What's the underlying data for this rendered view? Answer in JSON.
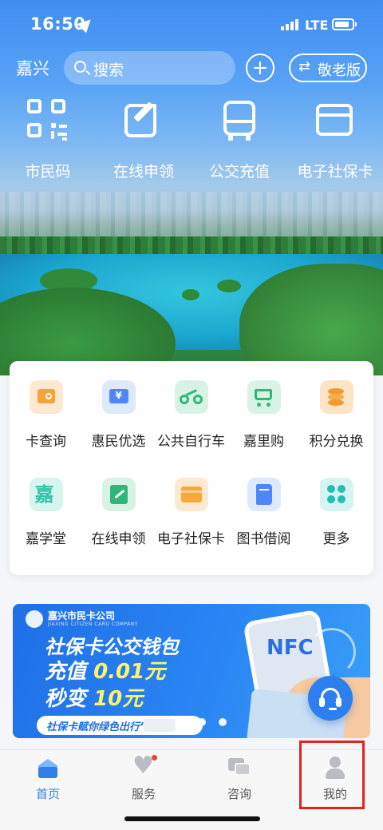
{
  "status": {
    "time": "16:50",
    "network": "LTE"
  },
  "topbar": {
    "city": "嘉兴",
    "search_placeholder": "搜索",
    "elder_mode": "敬老版"
  },
  "quick_actions": [
    {
      "label": "市民码",
      "icon": "qr-code-icon"
    },
    {
      "label": "在线申领",
      "icon": "edit-icon"
    },
    {
      "label": "公交充值",
      "icon": "bus-icon"
    },
    {
      "label": "电子社保卡",
      "icon": "card-icon"
    }
  ],
  "services": [
    {
      "label": "卡查询",
      "icon": "card-search-icon",
      "color": "#f7a23b"
    },
    {
      "label": "惠民优选",
      "icon": "coupon-icon",
      "color": "#4f86f7"
    },
    {
      "label": "公共自行车",
      "icon": "bicycle-icon",
      "color": "#2fb77a"
    },
    {
      "label": "嘉里购",
      "icon": "cart-icon",
      "color": "#2fb77a"
    },
    {
      "label": "积分兑换",
      "icon": "points-icon",
      "color": "#f39a2b"
    },
    {
      "label": "嘉学堂",
      "icon": "study-icon",
      "color": "#2ec4a6"
    },
    {
      "label": "在线申领",
      "icon": "apply-icon",
      "color": "#2fb77a"
    },
    {
      "label": "电子社保卡",
      "icon": "social-card-icon",
      "color": "#f5a93b"
    },
    {
      "label": "图书借阅",
      "icon": "book-icon",
      "color": "#4f86f7"
    },
    {
      "label": "更多",
      "icon": "more-icon",
      "color": "#22c0b3"
    }
  ],
  "banner": {
    "brand": "嘉兴市民卡公司",
    "brand_en": "JIAXING CITIZEN CARD COMPANY",
    "title": "社保卡公交钱包",
    "line2_prefix": "充值",
    "line2_value": "0.01元",
    "line3_prefix": "秒变",
    "line3_value": "10元",
    "strip": "社保卡赋你绿色出行“",
    "nfc": "NFC"
  },
  "tabs": [
    {
      "label": "首页",
      "active": true
    },
    {
      "label": "服务",
      "active": false
    },
    {
      "label": "咨询",
      "active": false
    },
    {
      "label": "我的",
      "active": false
    }
  ],
  "colors": {
    "accent": "#2f7fe8",
    "highlight": "#e0241b"
  }
}
